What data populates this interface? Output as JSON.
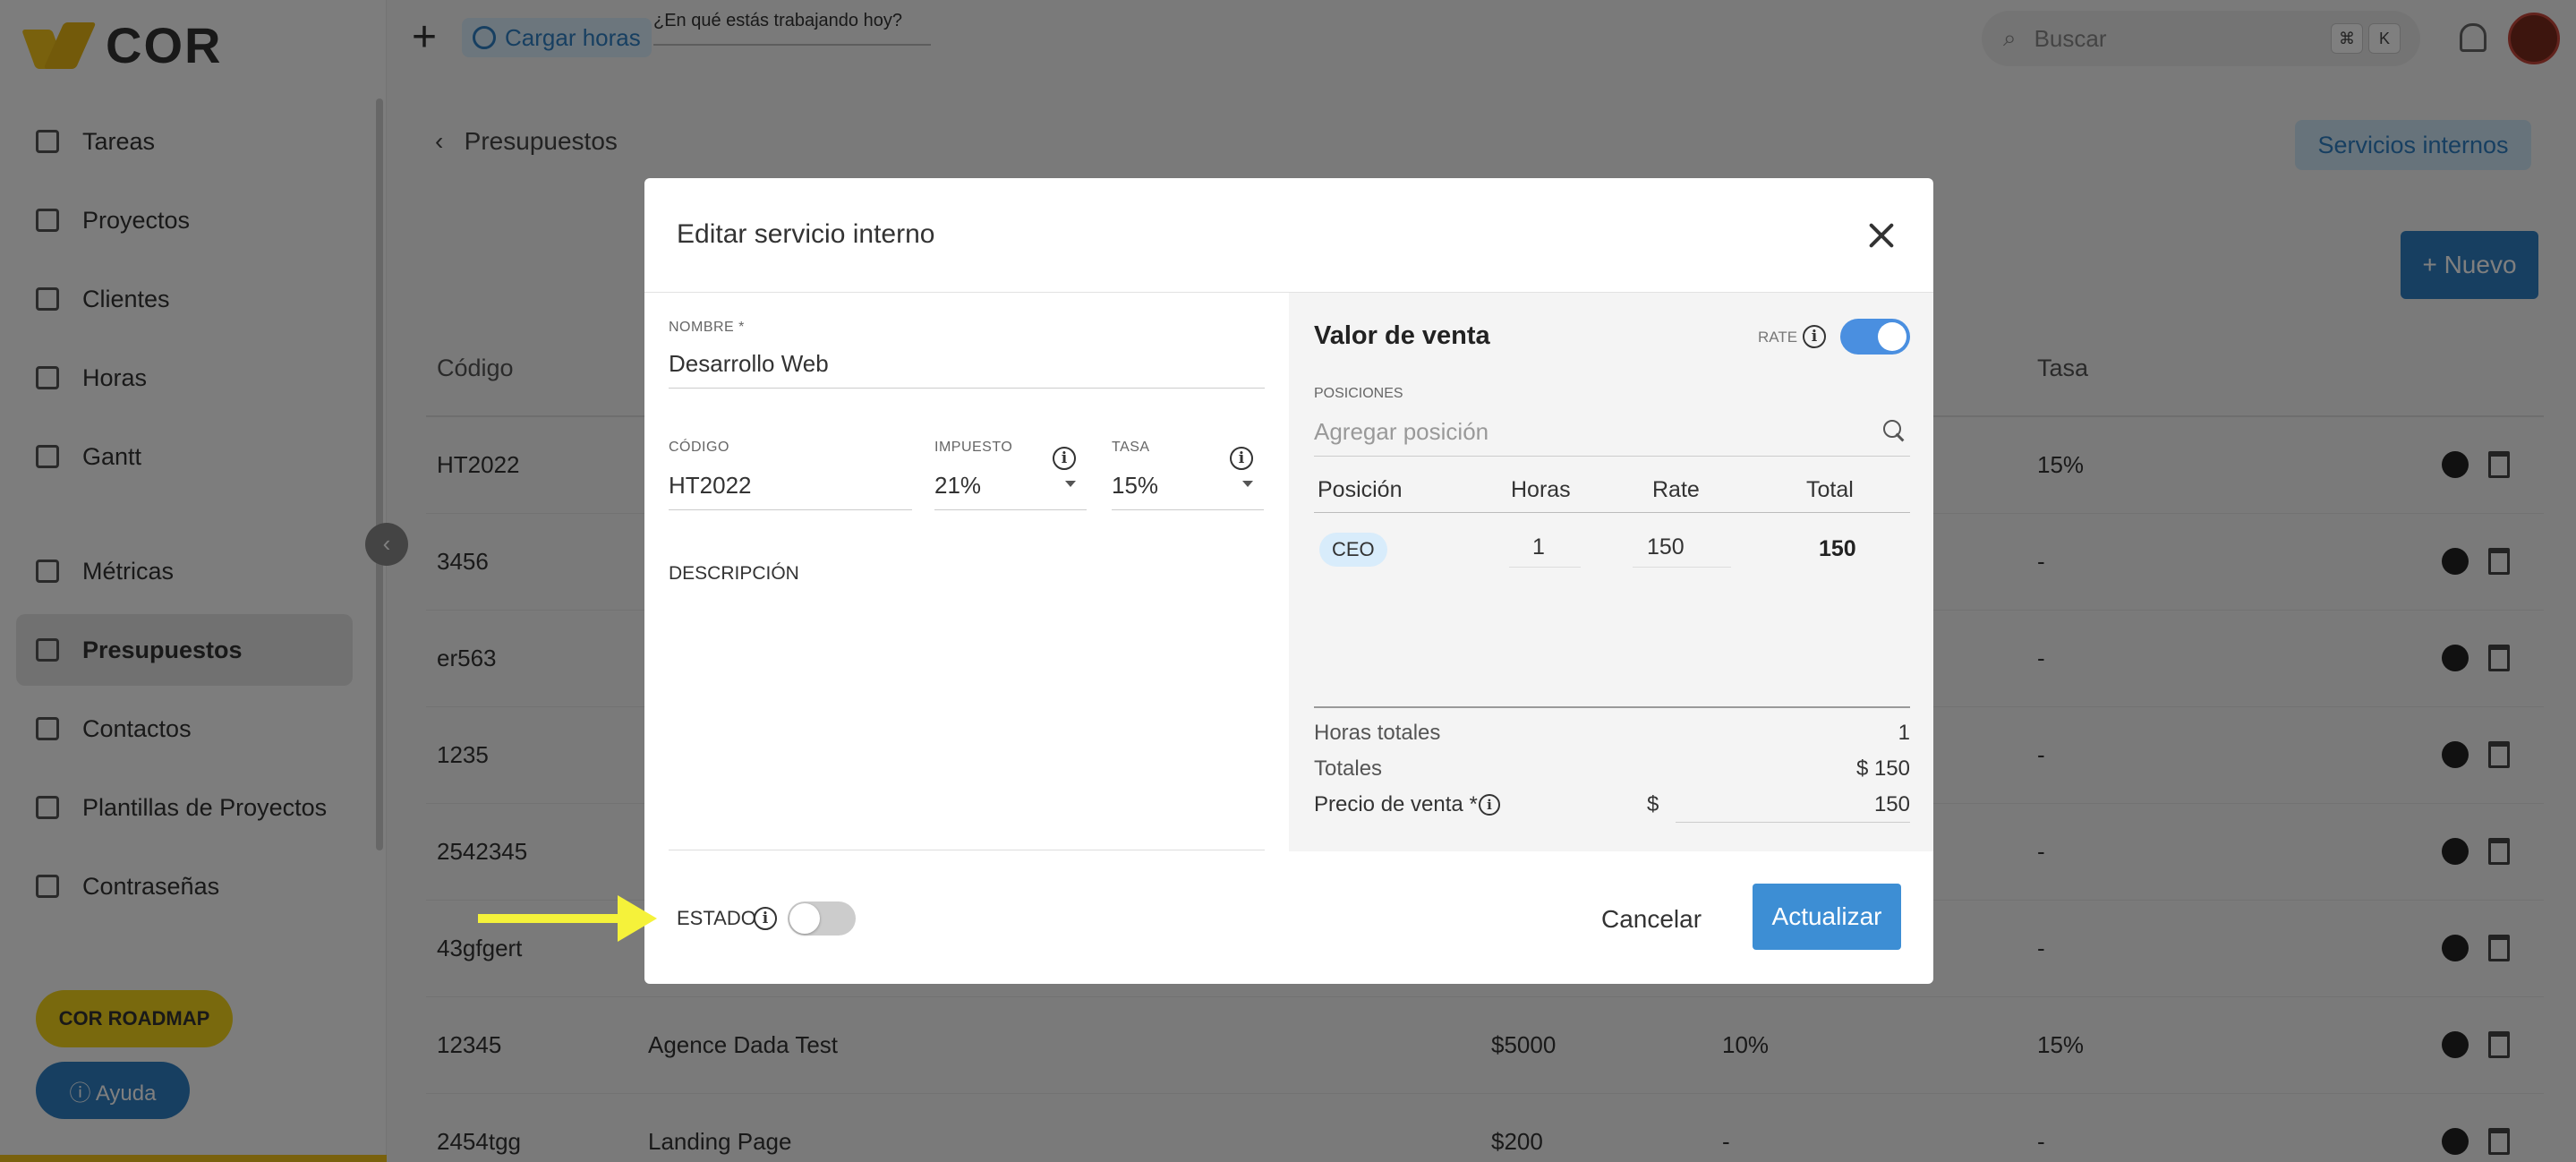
{
  "app": {
    "logo_text": "COR",
    "sidebar": {
      "items": [
        {
          "label": "Tareas"
        },
        {
          "label": "Proyectos"
        },
        {
          "label": "Clientes"
        },
        {
          "label": "Horas"
        },
        {
          "label": "Gantt"
        },
        {
          "label": "Métricas"
        },
        {
          "label": "Presupuestos"
        },
        {
          "label": "Contactos"
        },
        {
          "label": "Plantillas de Proyectos"
        },
        {
          "label": "Contraseñas"
        }
      ],
      "cor_pill": "COR ROADMAP",
      "help_pill": "ⓘ Ayuda"
    },
    "topbar": {
      "cargar_horas": "Cargar horas",
      "working_prompt": "¿En qué estás trabajando hoy?",
      "search_placeholder": "Buscar",
      "kbd_1": "⌘",
      "kbd_2": "K"
    },
    "breadcrumb": "Presupuestos",
    "servicios_internos": "Servicios internos",
    "nuevo": "+ Nuevo",
    "table": {
      "headers": {
        "codigo": "Código",
        "tasa": "Tasa"
      },
      "rows": [
        {
          "code": "HT2022",
          "name": "",
          "price": "",
          "imp": "",
          "tasa": "15%"
        },
        {
          "code": "3456",
          "name": "",
          "price": "",
          "imp": "",
          "tasa": "-"
        },
        {
          "code": "er563",
          "name": "",
          "price": "",
          "imp": "",
          "tasa": "-"
        },
        {
          "code": "1235",
          "name": "",
          "price": "",
          "imp": "",
          "tasa": "-"
        },
        {
          "code": "2542345",
          "name": "",
          "price": "",
          "imp": "",
          "tasa": "-"
        },
        {
          "code": "43gfgert",
          "name": "",
          "price": "",
          "imp": "",
          "tasa": "-"
        },
        {
          "code": "12345",
          "name": "Agence Dada Test",
          "price": "$5000",
          "imp": "10%",
          "tasa": "15%"
        },
        {
          "code": "2454tgg",
          "name": "Landing Page",
          "price": "$200",
          "imp": "-",
          "tasa": "-"
        }
      ]
    }
  },
  "modal": {
    "title": "Editar servicio interno",
    "nombre_label": "NOMBRE *",
    "nombre_value": "Desarrollo Web",
    "codigo_label": "CÓDIGO",
    "codigo_value": "HT2022",
    "impuesto_label": "IMPUESTO",
    "impuesto_value": "21%",
    "tasa_label": "TASA",
    "tasa_value": "15%",
    "descripcion_label": "DESCRIPCIÓN",
    "valor_venta": {
      "title": "Valor de venta",
      "rate_label": "RATE",
      "rate_enabled": true,
      "posiciones_label": "POSICIONES",
      "agregar_placeholder": "Agregar posición",
      "headers": {
        "posicion": "Posición",
        "horas": "Horas",
        "rate": "Rate",
        "total": "Total"
      },
      "rows": [
        {
          "posicion": "CEO",
          "horas": "1",
          "rate": "150",
          "total": "150"
        }
      ],
      "horas_totales_label": "Horas totales",
      "horas_totales_value": "1",
      "totales_label": "Totales",
      "totales_value": "$ 150",
      "precio_label": "Precio de venta *",
      "precio_currency": "$",
      "precio_value": "150"
    },
    "estado_label": "ESTADO",
    "estado_enabled": false,
    "cancel": "Cancelar",
    "update": "Actualizar"
  },
  "colors": {
    "accent_blue": "#3d8ed4",
    "toggle_blue": "#4a8fe0",
    "brand_yellow": "#f2c21b",
    "annotation_arrow": "#f5f23a"
  }
}
